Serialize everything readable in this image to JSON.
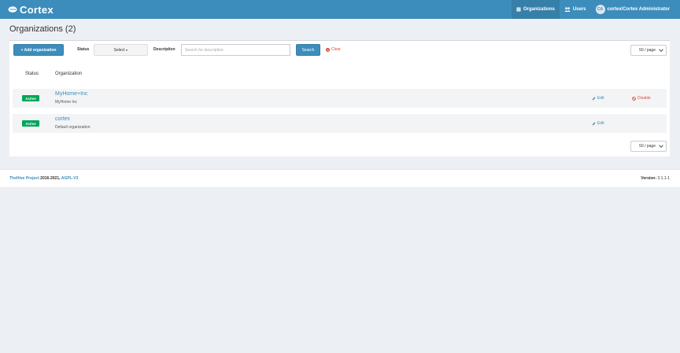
{
  "navbar": {
    "brand": "Cortex",
    "items": [
      {
        "label": "Organizations",
        "icon": "building-icon"
      },
      {
        "label": "Users",
        "icon": "users-icon"
      }
    ],
    "user": {
      "initials": "CA",
      "label": "cortex/Cortex Administrator"
    }
  },
  "page": {
    "title": "Organizations (2)"
  },
  "toolbar": {
    "add_label": "+ Add organization",
    "status_label": "Status",
    "status_select": "Select",
    "description_label": "Description",
    "description_placeholder": "Search for description",
    "search_label": "Search",
    "clear_label": "Clear",
    "page_size": "50 / page"
  },
  "table": {
    "headers": [
      "Status",
      "Organization"
    ],
    "rows": [
      {
        "status": "Active",
        "name": "MyHome+Inc",
        "description": "MyHome Inc",
        "edit": "Edit",
        "disable": "Disable"
      },
      {
        "status": "Active",
        "name": "cortex",
        "description": "Default organization",
        "edit": "Edit"
      }
    ]
  },
  "pagination": {
    "page_size": "50 / page"
  },
  "footer": {
    "project": "TheHive Project",
    "years": " 2016-2021, ",
    "license": "AGPL-V3",
    "version_label": "Version:",
    "version": " 3.1.1-1"
  },
  "colors": {
    "navbar": "#3c8dbc",
    "primary": "#3c8dbc",
    "success": "#00a65a",
    "danger": "#dd4b39",
    "background": "#eceff3"
  }
}
